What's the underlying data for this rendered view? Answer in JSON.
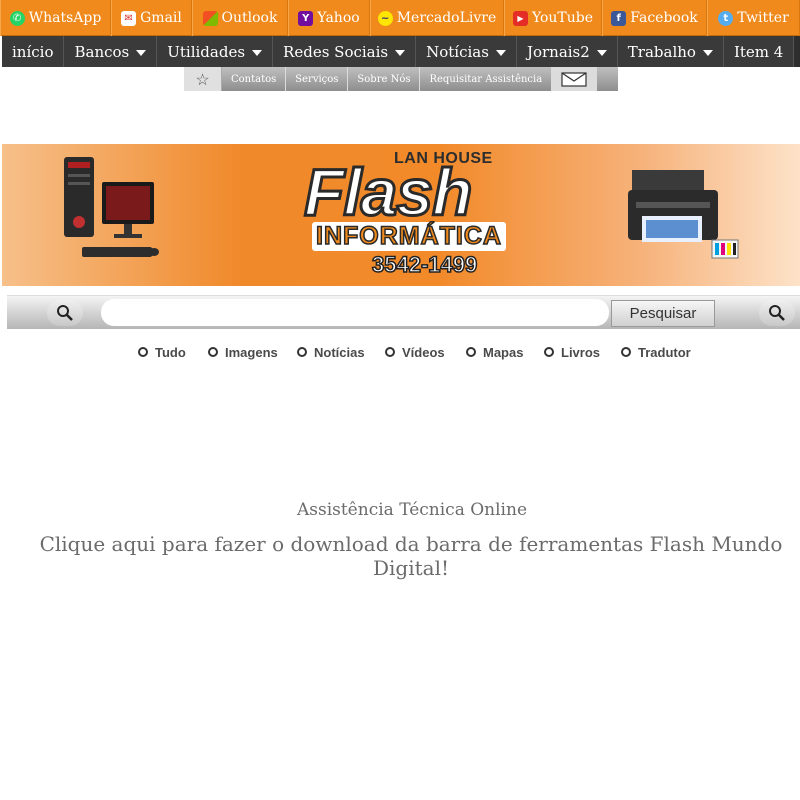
{
  "top_links": [
    {
      "label": "WhatsApp",
      "icon": "whatsapp-icon",
      "color": "#25d366"
    },
    {
      "label": "Gmail",
      "icon": "gmail-icon",
      "color": "#d93025"
    },
    {
      "label": "Outlook",
      "icon": "outlook-icon",
      "color": "#3a7bd5"
    },
    {
      "label": "Yahoo",
      "icon": "yahoo-icon",
      "color": "#720e9e"
    },
    {
      "label": "MercadoLivre",
      "icon": "mercadolivre-icon",
      "color": "#ffe600"
    },
    {
      "label": "YouTube",
      "icon": "youtube-icon",
      "color": "#e52d27"
    },
    {
      "label": "Facebook",
      "icon": "facebook-icon",
      "color": "#3b5998"
    },
    {
      "label": "Twitter",
      "icon": "twitter-icon",
      "color": "#55acee"
    }
  ],
  "nav": [
    {
      "label": "início",
      "dropdown": false
    },
    {
      "label": "Bancos",
      "dropdown": true
    },
    {
      "label": "Utilidades",
      "dropdown": true
    },
    {
      "label": "Redes Sociais",
      "dropdown": true
    },
    {
      "label": "Notícias",
      "dropdown": true
    },
    {
      "label": "Jornais2",
      "dropdown": true
    },
    {
      "label": "Trabalho",
      "dropdown": true
    },
    {
      "label": "Item 4",
      "dropdown": false
    }
  ],
  "subnav": {
    "items": [
      "Contatos",
      "Serviços",
      "Sobre Nós",
      "Requisitar Assistência"
    ],
    "star_icon": "star-icon",
    "mail_icon": "mail-icon"
  },
  "banner": {
    "lan_house": "LAN HOUSE",
    "brand": "Flash",
    "subtitle": "INFORMÁTICA",
    "phone": "3542-1499"
  },
  "search": {
    "value": "",
    "button_label": "Pesquisar",
    "left_icon": "search-icon",
    "right_icon": "search-icon",
    "options": [
      "Tudo",
      "Imagens",
      "Notícias",
      "Vídeos",
      "Mapas",
      "Livros",
      "Tradutor"
    ]
  },
  "content": {
    "assist_text": "Assistência Técnica Online",
    "download_text": "Clique aqui para fazer o download da barra de ferramentas Flash Mundo Digital!"
  },
  "colors": {
    "topbar": "#f08a1c",
    "nav": "#3a3a3a",
    "text_gray": "#6b6b6b"
  }
}
